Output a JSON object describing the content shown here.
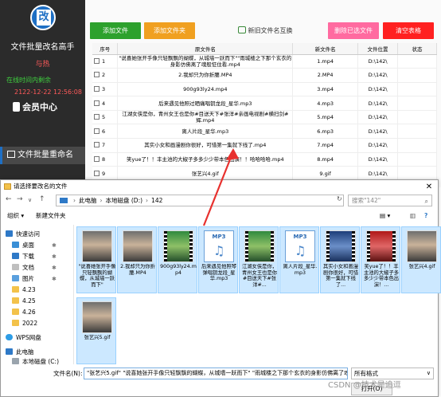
{
  "sidebar": {
    "logo_char": "改",
    "app_title": "文件批量改名高手",
    "author": "与热",
    "status": "在线时间内剩余",
    "datetime": "2122-12-22 12:56:08",
    "member_label": "会员中心",
    "nav_batch": "文件批量重命名"
  },
  "toolbar": {
    "add_file": "添加文件",
    "add_folder": "添加文件夹",
    "swap": "新旧文件名互换",
    "delete_selected": "删除已选文件",
    "clear_table": "清空表格"
  },
  "grid": {
    "headers": [
      "序号",
      "原文件名",
      "新文件名",
      "文件位置",
      "状态"
    ],
    "rows": [
      {
        "no": "1",
        "old": "\"说喜她张开手像只轻飘飘的蝴蝶，从城墙一跃而下\"\"雨城楼之下那个玄衣的身影仿佛离了魂般怔住看.mp4",
        "new": "1.mp4",
        "loc": "D:\\142\\"
      },
      {
        "no": "2",
        "old": "2.我却只为你折腰.MP4",
        "new": "2.MP4",
        "loc": "D:\\142\\"
      },
      {
        "no": "3",
        "old": "900g93ly24.mp4",
        "new": "3.mp4",
        "loc": "D:\\142\\"
      },
      {
        "no": "4",
        "old": "后来遇见他照过晒痛唱钥龙段_星华.mp3",
        "new": "4.mp3",
        "loc": "D:\\142\\"
      },
      {
        "no": "5",
        "old": "江湖女侠是你，青州女王也是你#目送天下#张洋#亲画电视剧#横扫剑#辉.mp4",
        "new": "5.mp4",
        "loc": "D:\\142\\"
      },
      {
        "no": "6",
        "old": "离人片段_星华.mp3",
        "new": "6.mp3",
        "loc": "D:\\142\\"
      },
      {
        "no": "7",
        "old": "其实小女和画漫剧你很好，可惜第一集就下线了.mp4",
        "new": "7.mp4",
        "loc": "D:\\142\\"
      },
      {
        "no": "8",
        "old": "笑yue了！！丰主池的大椒子多多少少带本色出演！！哈哈哈哈.mp4",
        "new": "8.mp4",
        "loc": "D:\\142\\"
      },
      {
        "no": "9",
        "old": "张艺兴4.gif",
        "new": "9.gif",
        "loc": "D:\\142\\"
      }
    ]
  },
  "dialog": {
    "title": "请选择要改名的文件",
    "close": "✕",
    "breadcrumb": [
      "此电脑",
      "本地磁盘 (D:)",
      "142"
    ],
    "search_placeholder": "搜索\"142\"",
    "organize": "组织 ▾",
    "new_folder": "新建文件夹",
    "nav": [
      "快速访问",
      "桌面",
      "下载",
      "文档",
      "图片",
      "4.23",
      "4.25",
      "4.26",
      "2022",
      "WPS网盘",
      "此电脑",
      "本地磁盘 (C:)"
    ],
    "files": [
      {
        "name": "\"说喜她张开手像只轻飘飘的蝴蝶，从城墙一跃而下\"",
        "kind": "photo"
      },
      {
        "name": "2.我却只为你折腰.MP4",
        "kind": "photo"
      },
      {
        "name": "900g93ly24.mp4",
        "kind": "green"
      },
      {
        "name": "后来遇见他照琴弹唱钥龙段_星华.mp3",
        "kind": "mp3"
      },
      {
        "name": "江湖女侠是你，青州女王也是你#目送天下#张洋#...",
        "kind": "green"
      },
      {
        "name": "离人片段_星华.mp3",
        "kind": "mp3"
      },
      {
        "name": "其实小女和画漫剧你很好，可惜第一集就下线了...",
        "kind": "blue"
      },
      {
        "name": "笑yue了！！丰主池的大椒子多多少少带本色出演！...",
        "kind": "red"
      },
      {
        "name": "张艺兴4.gif",
        "kind": "photo"
      },
      {
        "name": "张艺兴5.gif",
        "kind": "photo"
      }
    ],
    "filename_label": "文件名(N):",
    "filename_value": "\"张艺兴5.gif\" \"说喜她张开手像只轻飘飘的蝴蝶，从城墙一跃而下\" \"雨城楼之下那个玄衣的身影仿佛离了魂般怔住",
    "filter": "所有格式",
    "open_button": "打开(O)"
  },
  "watermark": "CSDN @技术是追逗"
}
